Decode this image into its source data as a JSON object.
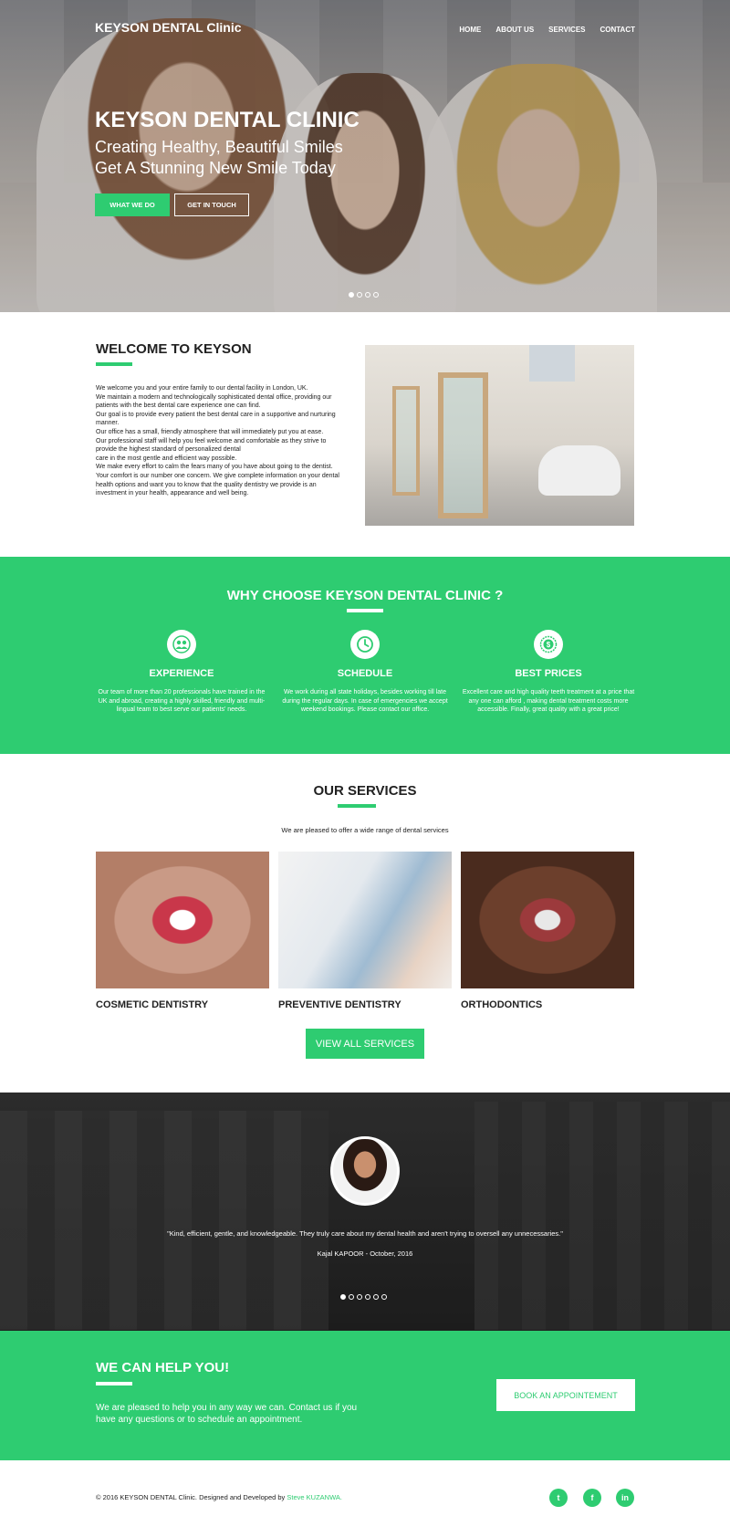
{
  "brand": "KEYSON DENTAL Clinic",
  "nav": [
    "HOME",
    "ABOUT US",
    "SERVICES",
    "CONTACT"
  ],
  "hero": {
    "title": "KEYSON DENTAL CLINIC",
    "subtitle1": "Creating Healthy, Beautiful Smiles",
    "subtitle2": "Get A Stunning New Smile Today",
    "btn_primary": "WHAT WE DO",
    "btn_secondary": "GET IN TOUCH"
  },
  "welcome": {
    "title": "WELCOME TO KEYSON",
    "lines": [
      "We welcome you and your entire family to our dental facility in London, UK.",
      "We maintain a modern and technologically sophisticated dental office, providing our patients with the best dental care experience one can find.",
      "Our goal is to provide every patient the best dental care in a supportive and nurturing manner.",
      "Our office has a small, friendly atmosphere that will immediately put you at ease.",
      "Our professional staff will help you feel welcome and comfortable as they strive to provide the highest standard of personalized dental",
      "care in the most gentle and efficient way possible.",
      "We make every effort to calm the fears many of you have about going to the dentist.",
      "Your comfort is our number one concern. We give complete information on your dental health options and want you to know that the quality dentistry we provide is an investment in your health, appearance and well being."
    ]
  },
  "why": {
    "title": "WHY CHOOSE KEYSON DENTAL CLINIC ?",
    "features": [
      {
        "title": "EXPERIENCE",
        "icon": "team-icon",
        "text": "Our team of more than 20 professionals have trained in the UK and abroad, creating a highly skilled, friendly and multi-lingual team to best serve our patients' needs."
      },
      {
        "title": "SCHEDULE",
        "icon": "clock-icon",
        "text": "We work during all state holidays, besides working till late during the regular days. In case of emergencies we accept weekend bookings. Please contact our office."
      },
      {
        "title": "BEST PRICES",
        "icon": "dollar-badge-icon",
        "text": "Excellent care and high quality teeth treatment at a price that any one can afford , making dental treatment costs more accessible. Finally, great quality with a great price!"
      }
    ]
  },
  "services": {
    "title": "OUR SERVICES",
    "subtitle": "We are pleased to offer a wide range of dental services",
    "items": [
      "COSMETIC DENTISTRY",
      "PREVENTIVE DENTISTRY",
      "ORTHODONTICS"
    ],
    "view_all": "VIEW ALL SERVICES"
  },
  "testimonial": {
    "quote": "\"Kind, efficient, gentle, and knowledgeable. They truly care about my dental health and aren't trying to oversell any unnecessaries.\"",
    "author": "Kajal KAPOOR - October, 2016"
  },
  "cta": {
    "title": "WE CAN HELP YOU!",
    "text": "We are pleased to help you in any way we can. Contact us if you have any questions or to schedule an appointment.",
    "button": "BOOK AN APPOINTEMENT"
  },
  "footer": {
    "copyright": "© 2016 KEYSON DENTAL Clinic. Designed and Developed by ",
    "developer": "Steve KUZANWA.",
    "social": [
      "twitter-icon",
      "facebook-icon",
      "linkedin-icon"
    ],
    "social_glyphs": [
      "t",
      "f",
      "in"
    ]
  },
  "colors": {
    "accent": "#2ecc71"
  }
}
